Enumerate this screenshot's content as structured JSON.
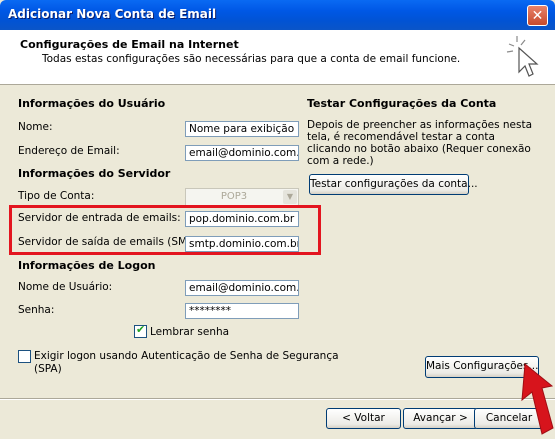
{
  "window": {
    "title": "Adicionar Nova Conta de Email",
    "close_symbol": "✕"
  },
  "header": {
    "title": "Configurações de Email na Internet",
    "subtitle": "Todas estas configurações são necessárias para que a conta de email funcione."
  },
  "user_info": {
    "heading": "Informações do Usuário",
    "name_label": "Nome:",
    "name_value": "Nome para exibição",
    "email_label": "Endereço de Email:",
    "email_value": "email@dominio.com.br"
  },
  "server_info": {
    "heading": "Informações do Servidor",
    "account_type_label": "Tipo de Conta:",
    "account_type_value": "POP3",
    "incoming_label": "Servidor de entrada de emails:",
    "incoming_value": "pop.dominio.com.br",
    "outgoing_label": "Servidor de saída de emails (SMTP):",
    "outgoing_value": "smtp.dominio.com.br"
  },
  "logon_info": {
    "heading": "Informações de Logon",
    "username_label": "Nome de Usuário:",
    "username_value": "email@dominio.com.br",
    "password_label": "Senha:",
    "password_value": "********",
    "remember_label": "Lembrar senha",
    "remember_checked": true,
    "spa_label_line1": "Exigir logon usando Autenticação de Senha de Segurança",
    "spa_label_line2": "(SPA)",
    "spa_checked": false
  },
  "test_section": {
    "heading": "Testar Configurações da Conta",
    "description": "Depois de preencher as informações nesta tela, é recomendável testar a conta clicando no botão abaixo (Requer conexão com a rede.)",
    "test_button": "Testar configurações da conta..."
  },
  "buttons": {
    "more_settings": "Mais Configurações...",
    "back": "< Voltar",
    "next": "Avançar >",
    "cancel": "Cancelar"
  },
  "annotations": {
    "highlight_color": "#E3151F",
    "arrow_color": "#D7141C"
  },
  "icons": {
    "wizard": "cursor-sparkle-icon",
    "dropdown": "chevron-down-icon"
  }
}
